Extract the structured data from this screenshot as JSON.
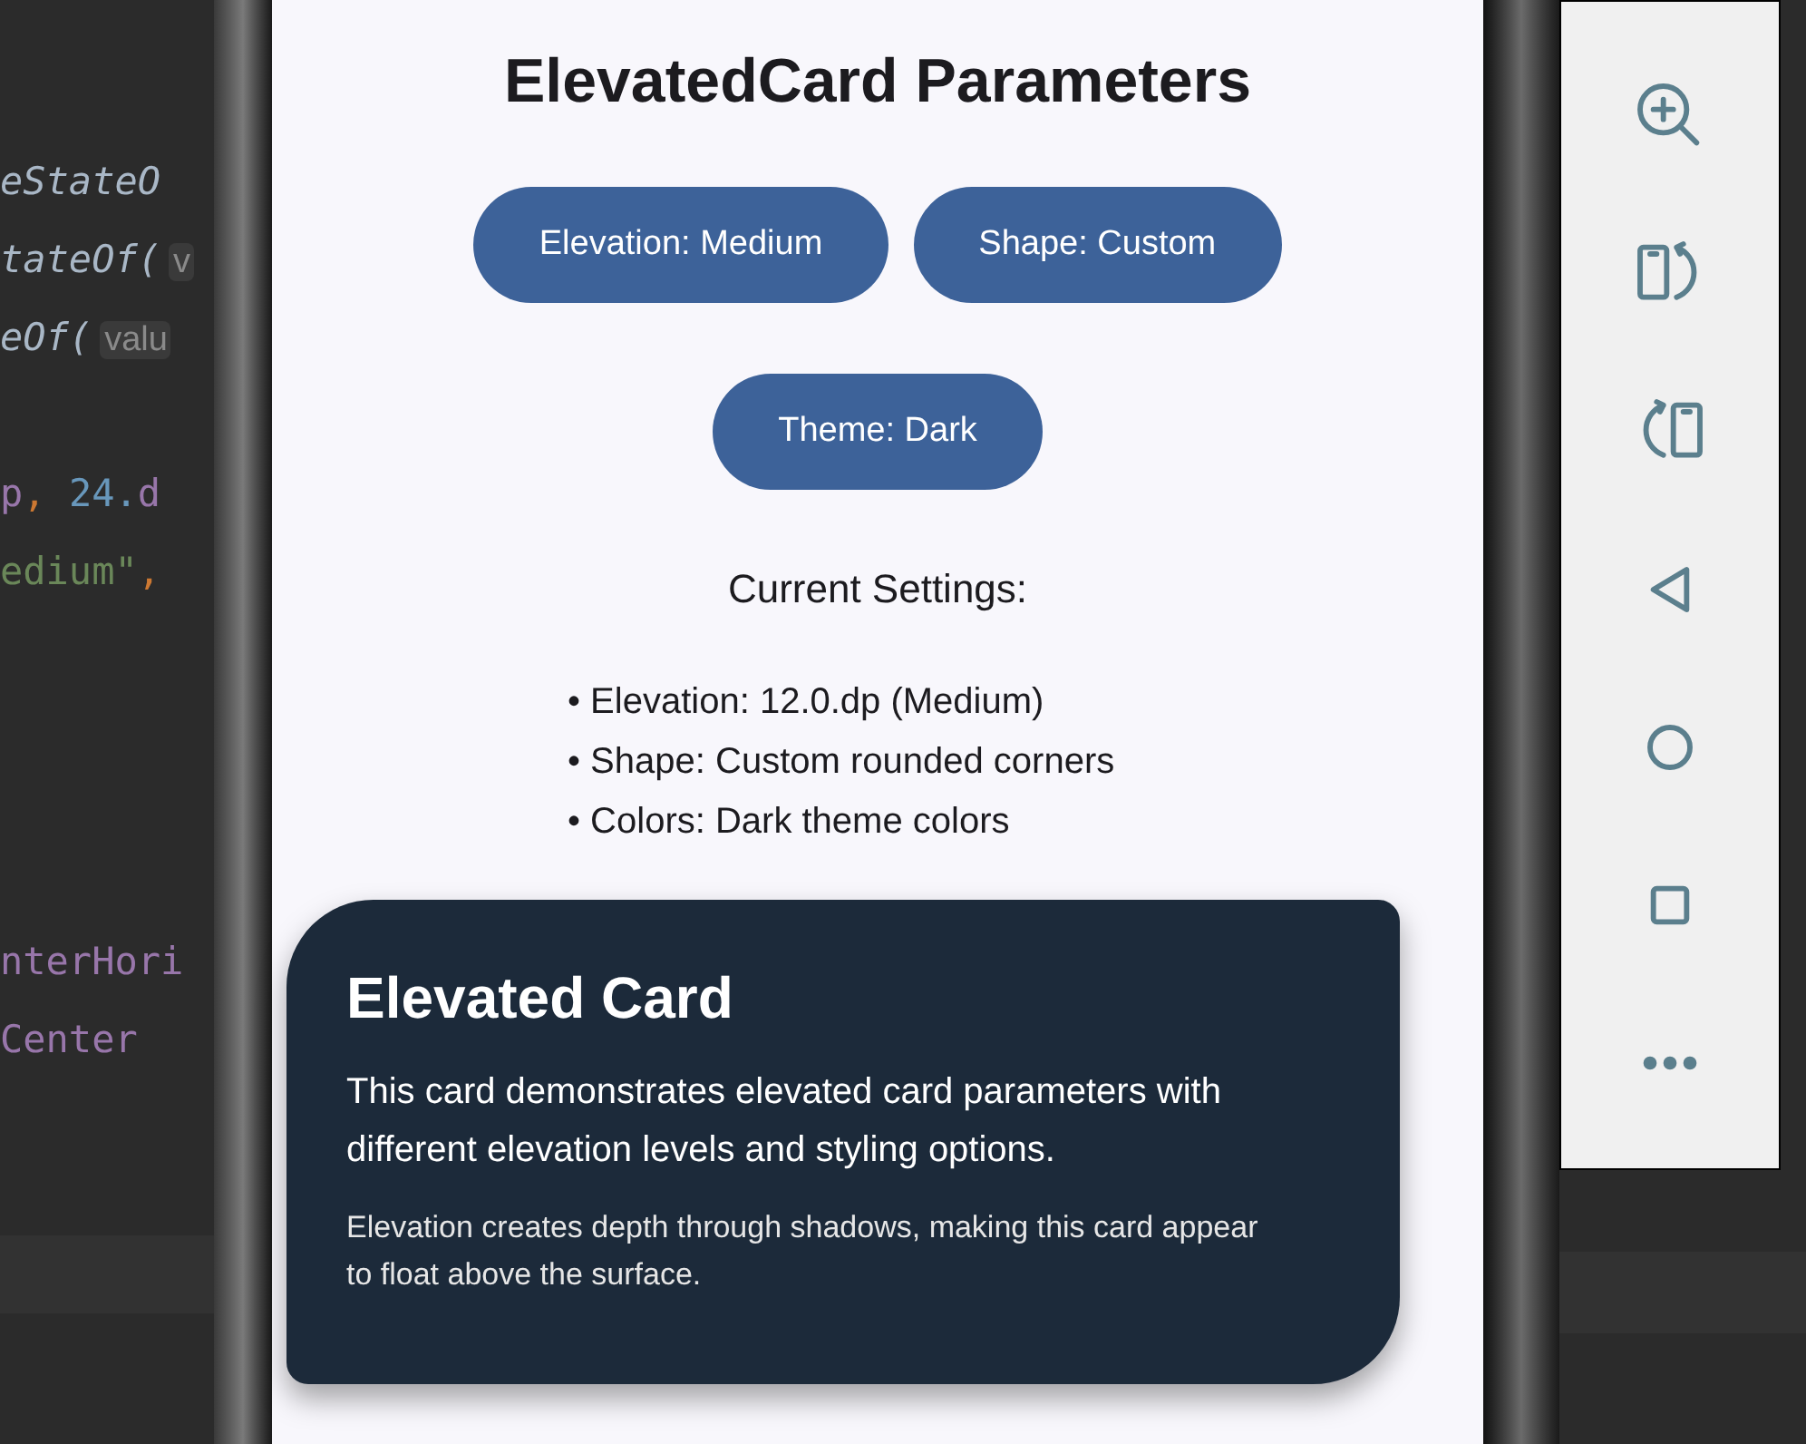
{
  "code_editor": {
    "lines": [
      {
        "tokens": [
          {
            "text": "eStateO",
            "kind": "call"
          }
        ]
      },
      {
        "tokens": [
          {
            "text": "tateOf(",
            "kind": "call"
          },
          {
            "text": "v",
            "kind": "hint"
          }
        ]
      },
      {
        "tokens": [
          {
            "text": "eOf(",
            "kind": "call"
          },
          {
            "text": "valu",
            "kind": "hint"
          }
        ]
      },
      {
        "tokens": [
          {
            "text": "p",
            "kind": "prop"
          },
          {
            "text": ", ",
            "kind": "punct"
          },
          {
            "text": "24.",
            "kind": "number"
          },
          {
            "text": "d",
            "kind": "prop"
          }
        ]
      },
      {
        "tokens": [
          {
            "text": "edium\"",
            "kind": "string"
          },
          {
            "text": ",",
            "kind": "punct"
          }
        ]
      },
      {
        "tokens": [
          {
            "text": "nterHori",
            "kind": "prop"
          }
        ]
      },
      {
        "tokens": [
          {
            "text": "Center",
            "kind": "prop"
          }
        ]
      }
    ]
  },
  "app": {
    "title": "ElevatedCard Parameters",
    "buttons": [
      {
        "label": "Elevation: Medium"
      },
      {
        "label": "Shape: Custom"
      },
      {
        "label": "Theme: Dark"
      }
    ],
    "settings_heading": "Current Settings:",
    "settings": [
      "• Elevation: 12.0.dp (Medium)",
      "• Shape: Custom rounded corners",
      "• Colors: Dark theme colors"
    ],
    "card": {
      "title": "Elevated Card",
      "body": "This card demonstrates elevated card parameters with different elevation levels and styling options.",
      "note": "Elevation creates depth through shadows, making this card appear to float above the surface."
    }
  }
}
